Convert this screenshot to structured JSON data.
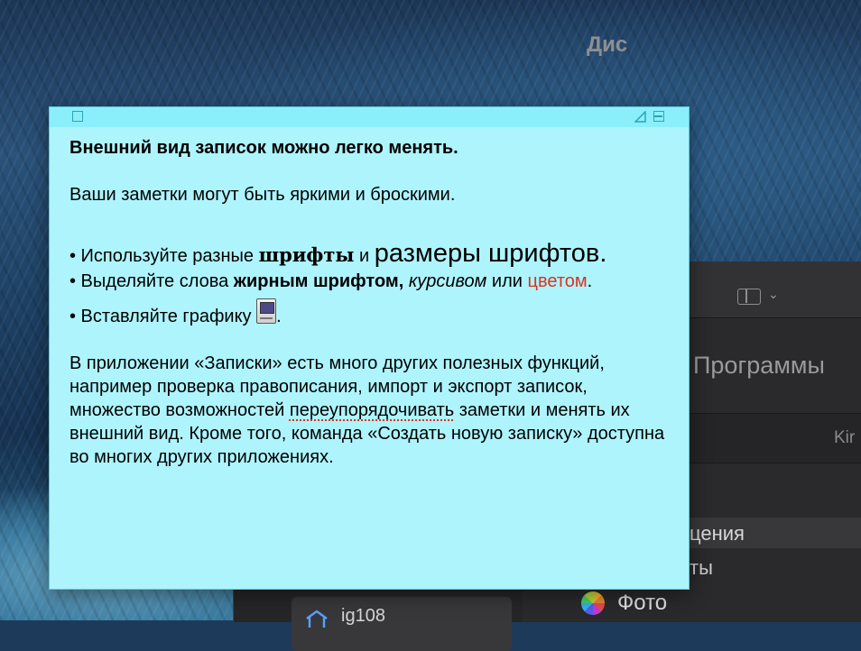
{
  "note": {
    "heading": "Внешний вид записок можно легко менять.",
    "intro": "Ваши заметки могут быть яркими и броскими.",
    "bullet1": {
      "prefix": "• Используйте разные ",
      "fonts_word": "шрифты",
      "and": " и ",
      "sizes_word": "размеры шрифтов",
      "suffix": "."
    },
    "bullet2": {
      "prefix": "• Выделяйте слова ",
      "bold_word": "жирным шрифтом,",
      "space": " ",
      "italic_word": "курсивом",
      "or": " или ",
      "color_word": "цветом",
      "suffix": "."
    },
    "bullet3": {
      "prefix": "• Вставляйте графику ",
      "suffix": "."
    },
    "paragraph": {
      "part1": "В приложении «Записки» есть много других полезных функций, например проверка правописания, импорт и экспорт записок, множество возможностей ",
      "misspelled": "переупорядочивать",
      "part2": " заметки и менять их внешний вид. Кроме того, команда «Создать новую записку» доступна во многих других приложениях."
    },
    "colors": {
      "background": "#aef4fc",
      "titlebar": "#8beffb",
      "accent_red": "#e0301e"
    }
  },
  "finder": {
    "right_title": "Дис",
    "programs_title": "Программы",
    "column_header": "Kir",
    "rows": {
      "apps_partial": "цения",
      "docs_partial": "ты",
      "photos": "Фото"
    },
    "sidebar_partial": "ig108",
    "icons": {
      "view_toggle": "sidebar-toggle-icon",
      "photos": "photos-app-icon",
      "home": "home-icon"
    }
  }
}
